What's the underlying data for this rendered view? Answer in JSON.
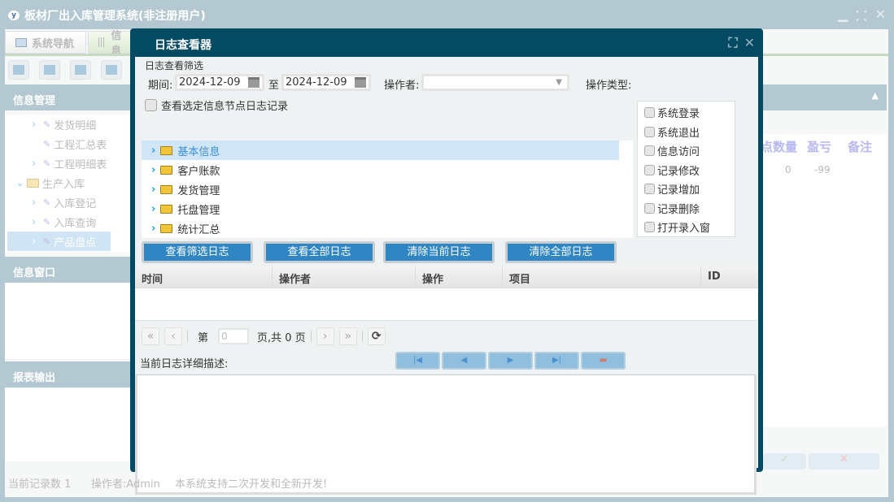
{
  "app": {
    "title": "板材厂出入库管理系统(非注册用户)",
    "window_controls": [
      "minimize",
      "restore",
      "close"
    ]
  },
  "tabs": [
    {
      "label": "系统导航"
    },
    {
      "label": "信息"
    }
  ],
  "sidebar": {
    "sections": [
      {
        "title": "信息管理"
      },
      {
        "title": "信息窗口"
      },
      {
        "title": "报表输出"
      }
    ],
    "items": [
      {
        "label": "发货明细",
        "arrow": true
      },
      {
        "label": "工程汇总表",
        "arrow": false
      },
      {
        "label": "工程明细表",
        "arrow": true
      },
      {
        "label": "生产入库",
        "folder": true
      },
      {
        "label": "入库登记",
        "arrow": true
      },
      {
        "label": "入库查询",
        "arrow": true
      },
      {
        "label": "产品盘点",
        "arrow": true,
        "selected": true
      }
    ]
  },
  "background_table": {
    "columns": [
      "点数量",
      "盈亏",
      "备注"
    ],
    "row": [
      "0",
      "-99",
      ""
    ],
    "ok": "✓",
    "cancel": "✕"
  },
  "status_bar": {
    "records": "当前记录数 1",
    "operator": "操作者:Admin",
    "note": "本系统支持二次开发和全新开发!"
  },
  "dialog": {
    "title": "日志查看器",
    "filter_title": "日志查看筛选",
    "period_label": "期间:",
    "date_from": "2024-12-09",
    "to_label": "至",
    "date_to": "2024-12-09",
    "operator_label": "操作者:",
    "operator_value": "",
    "optype_label": "操作类型:",
    "optypes": [
      "系统登录",
      "系统退出",
      "信息访问",
      "记录修改",
      "记录增加",
      "记录删除",
      "打开录入窗"
    ],
    "node_checkbox": "查看选定信息节点日志记录",
    "tree": [
      "基本信息",
      "客户账款",
      "发货管理",
      "托盘管理",
      "统计汇总"
    ],
    "buttons": [
      "查看筛选日志",
      "查看全部日志",
      "清除当前日志",
      "清除全部日志"
    ],
    "grid_columns": [
      "时间",
      "操作者",
      "操作",
      "项目",
      "ID"
    ],
    "pager": {
      "page_label": "第",
      "page_value": "0",
      "total_label": "页,共 0 页"
    },
    "desc_label": "当前日志详细描述:",
    "desc_nav": [
      "|◀",
      "◀",
      "▶",
      "▶|",
      "▬"
    ],
    "accent": "#2f86c3",
    "frame": "#044a63"
  }
}
